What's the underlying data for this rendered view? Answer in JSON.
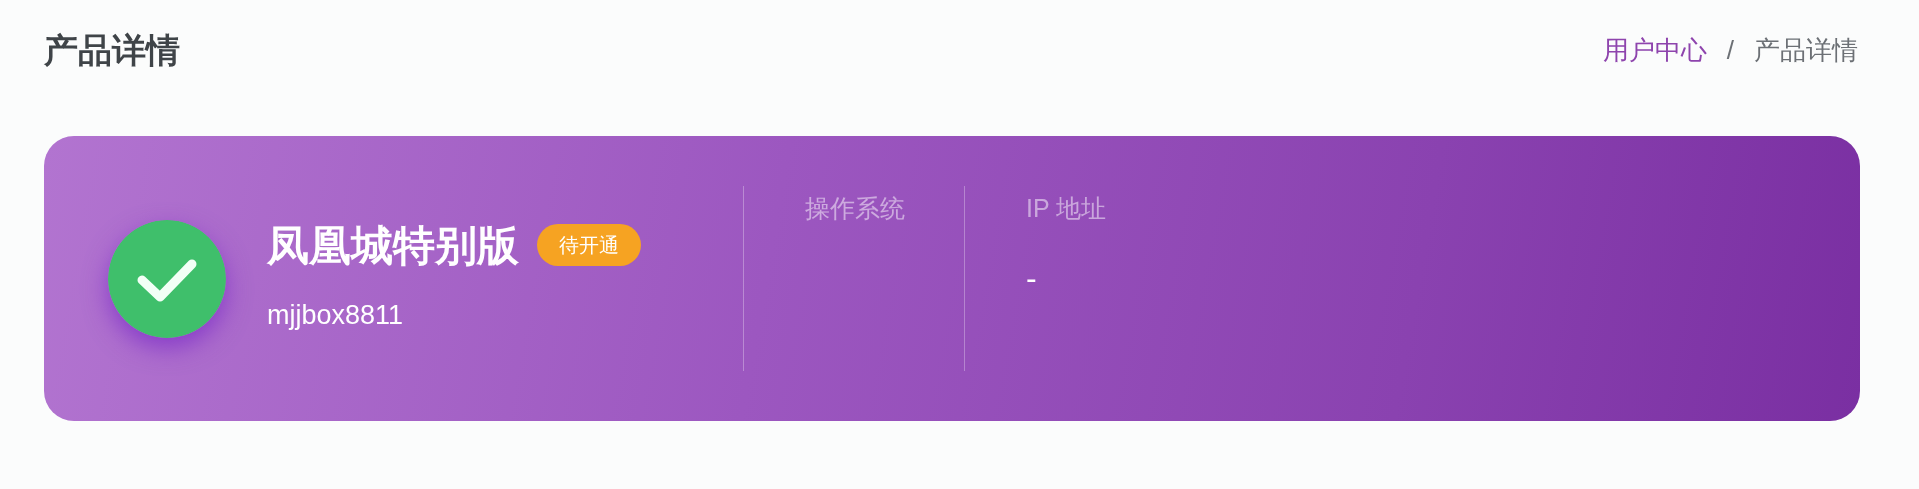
{
  "page": {
    "title": "产品详情"
  },
  "breadcrumb": [
    {
      "label": "用户中心",
      "link": true
    },
    {
      "label": "/",
      "link": false
    },
    {
      "label": "产品详情",
      "link": false
    }
  ],
  "product": {
    "name": "凤凰城特别版",
    "status": "待开通",
    "username": "mjjbox8811",
    "fields": [
      {
        "label": "操作系统"
      },
      {
        "label": "IP 地址",
        "value": "-"
      }
    ]
  }
}
